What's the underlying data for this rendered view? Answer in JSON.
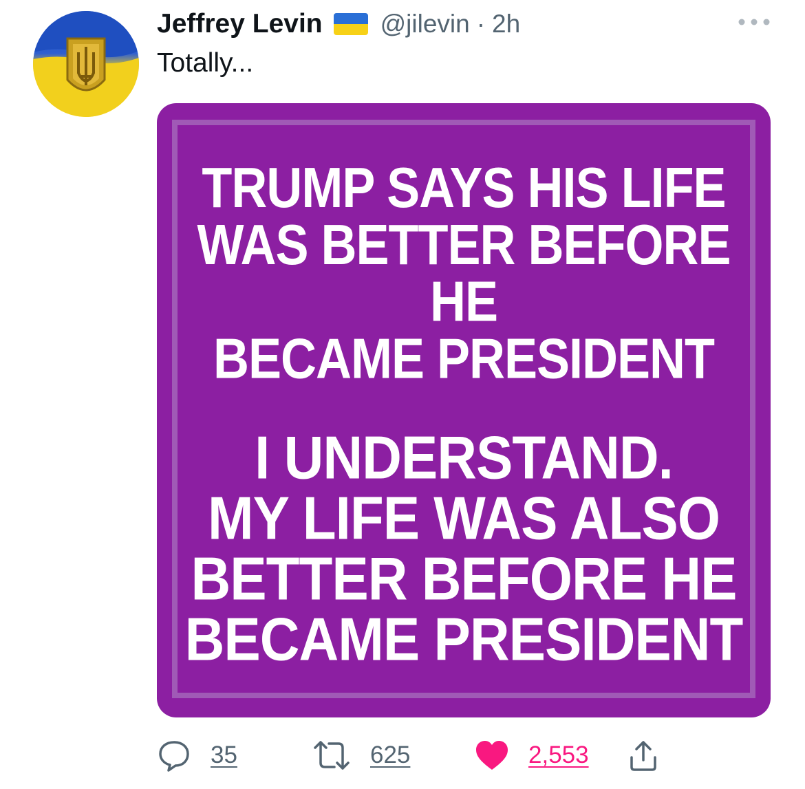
{
  "tweet": {
    "author": {
      "display_name": "Jeffrey Levin",
      "handle": "@jilevin",
      "separator": "·",
      "time": "2h",
      "flag_icon": "ukraine-flag-icon"
    },
    "text": "Totally...",
    "image": {
      "caption_top": "TRUMP SAYS HIS LIFE\nWAS BETTER BEFORE HE\nBECAME PRESIDENT",
      "caption_bottom": "I UNDERSTAND.\nMY LIFE  WAS ALSO\nBETTER BEFORE HE\nBECAME PRESIDENT",
      "background_color": "#8c1fa2",
      "text_color": "#ffffff"
    },
    "actions": {
      "replies": "35",
      "retweets": "625",
      "likes": "2,553",
      "liked": true
    }
  },
  "colors": {
    "secondary_text": "#536471",
    "like_color": "#f91880"
  }
}
